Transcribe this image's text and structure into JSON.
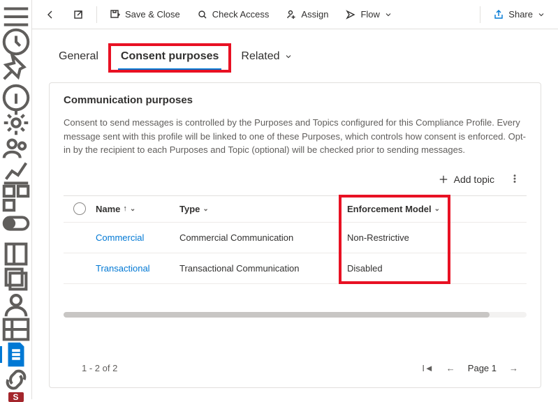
{
  "cmdbar": {
    "save_close": "Save & Close",
    "check_access": "Check Access",
    "assign": "Assign",
    "flow": "Flow",
    "share": "Share"
  },
  "tabs": {
    "general": "General",
    "consent": "Consent purposes",
    "related": "Related"
  },
  "card": {
    "title": "Communication purposes",
    "body": "Consent to send messages is controlled by the Purposes and Topics configured for this Compliance Profile. Every message sent with this profile will be linked to one of these Purposes, which controls how consent is enforced. Opt-in by the recipient to each Purposes and Topic (optional) will be checked prior to sending messages.",
    "add_topic": "Add topic"
  },
  "grid": {
    "cols": {
      "name": "Name",
      "type": "Type",
      "enf": "Enforcement Model"
    },
    "rows": [
      {
        "name": "Commercial",
        "type": "Commercial Communication",
        "enf": "Non-Restrictive"
      },
      {
        "name": "Transactional",
        "type": "Transactional Communication",
        "enf": "Disabled"
      }
    ]
  },
  "pager": {
    "status": "1 - 2 of 2",
    "page": "Page 1"
  },
  "sbadge": "S"
}
